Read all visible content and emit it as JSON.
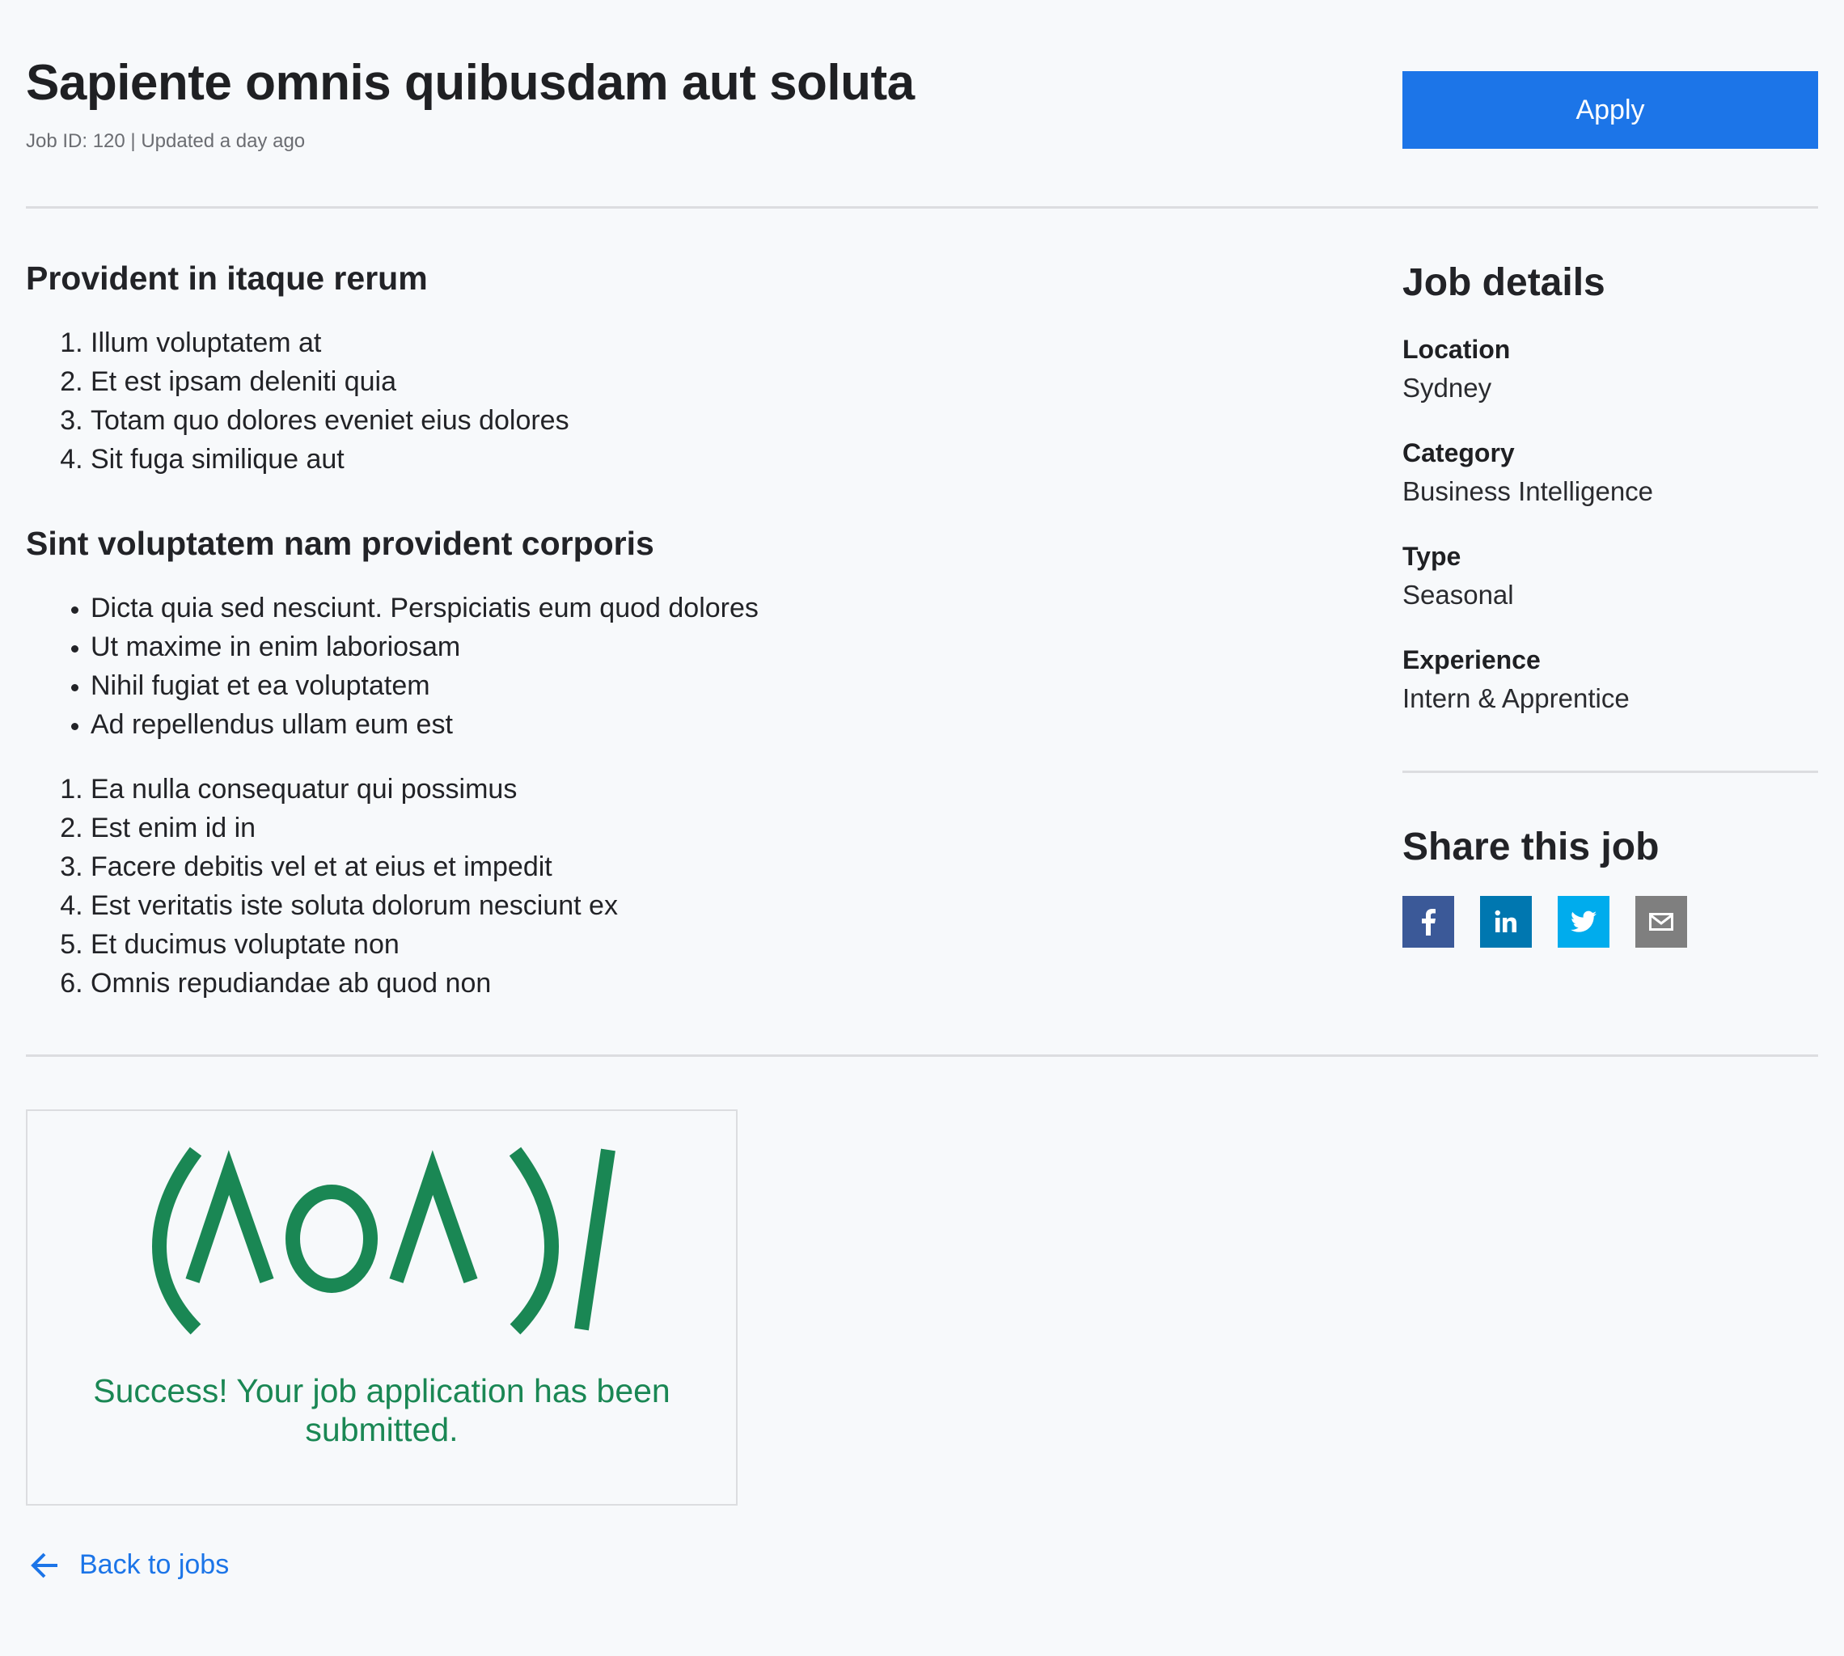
{
  "header": {
    "title": "Sapiente omnis quibusdam aut soluta",
    "meta": "Job ID: 120 | Updated a day ago",
    "apply_label": "Apply"
  },
  "main": {
    "sections": [
      {
        "heading": "Provident in itaque rerum",
        "ordered_list": [
          "Illum voluptatem at",
          "Et est ipsam deleniti quia",
          "Totam quo dolores eveniet eius dolores",
          "Sit fuga similique aut"
        ]
      },
      {
        "heading": "Sint voluptatem nam provident corporis",
        "bullet_list": [
          "Dicta quia sed nesciunt. Perspiciatis eum quod dolores",
          "Ut maxime in enim laboriosam",
          "Nihil fugiat et ea voluptatem",
          "Ad repellendus ullam eum est"
        ],
        "ordered_list": [
          "Ea nulla consequatur qui possimus",
          "Est enim id in",
          "Facere debitis vel et at eius et impedit",
          "Est veritatis iste soluta dolorum nesciunt ex",
          "Et ducimus voluptate non",
          "Omnis repudiandae ab quod non"
        ]
      }
    ]
  },
  "sidebar": {
    "details_heading": "Job details",
    "details": [
      {
        "label": "Location",
        "value": "Sydney"
      },
      {
        "label": "Category",
        "value": "Business Intelligence"
      },
      {
        "label": "Type",
        "value": "Seasonal"
      },
      {
        "label": "Experience",
        "value": "Intern & Apprentice"
      }
    ],
    "share_heading": "Share this job",
    "share_buttons": [
      {
        "icon": "facebook-icon",
        "color": "#3b5998"
      },
      {
        "icon": "linkedin-icon",
        "color": "#0077b0"
      },
      {
        "icon": "twitter-icon",
        "color": "#00aced"
      },
      {
        "icon": "email-icon",
        "color": "#7f7f7f"
      }
    ]
  },
  "success": {
    "emoticon": "(^o^)/",
    "message": "Success! Your job application has been submitted.",
    "color": "#1a8754"
  },
  "footer": {
    "back_label": "Back to jobs"
  },
  "colors": {
    "accent": "#1c75e8",
    "background": "#f7f9fb",
    "divider": "#dcdde0"
  }
}
